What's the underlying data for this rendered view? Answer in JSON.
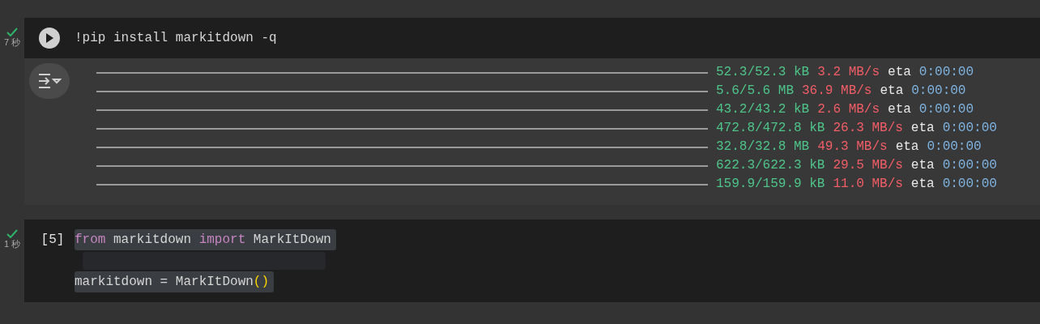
{
  "cells": [
    {
      "status": {
        "done": true,
        "time": "7 秒"
      },
      "gutter": {
        "kind": "run"
      },
      "code": [
        [
          {
            "kind": "command",
            "text": "!pip install markitdown -q"
          }
        ]
      ],
      "output": {
        "rows": [
          {
            "size": "52.3/52.3 kB",
            "speed": "3.2 MB/s",
            "eta_label": "eta",
            "eta": "0:00:00"
          },
          {
            "size": "5.6/5.6 MB",
            "speed": "36.9 MB/s",
            "eta_label": "eta",
            "eta": "0:00:00"
          },
          {
            "size": "43.2/43.2 kB",
            "speed": "2.6 MB/s",
            "eta_label": "eta",
            "eta": "0:00:00"
          },
          {
            "size": "472.8/472.8 kB",
            "speed": "26.3 MB/s",
            "eta_label": "eta",
            "eta": "0:00:00"
          },
          {
            "size": "32.8/32.8 MB",
            "speed": "49.3 MB/s",
            "eta_label": "eta",
            "eta": "0:00:00"
          },
          {
            "size": "622.3/622.3 kB",
            "speed": "29.5 MB/s",
            "eta_label": "eta",
            "eta": "0:00:00"
          },
          {
            "size": "159.9/159.9 kB",
            "speed": "11.0 MB/s",
            "eta_label": "eta",
            "eta": "0:00:00"
          }
        ]
      }
    },
    {
      "status": {
        "done": true,
        "time": "1 秒"
      },
      "gutter": {
        "kind": "count",
        "text": "[5]"
      },
      "code": [
        [
          {
            "kind": "keyword",
            "text": "from"
          },
          {
            "kind": "plain",
            "text": " markitdown "
          },
          {
            "kind": "keyword",
            "text": "import"
          },
          {
            "kind": "plain",
            "text": " MarkItDown"
          }
        ],
        {
          "kind": "blank"
        },
        [
          {
            "kind": "plain",
            "text": "markitdown = MarkItDown"
          },
          {
            "kind": "paren",
            "text": "()"
          }
        ]
      ]
    }
  ]
}
